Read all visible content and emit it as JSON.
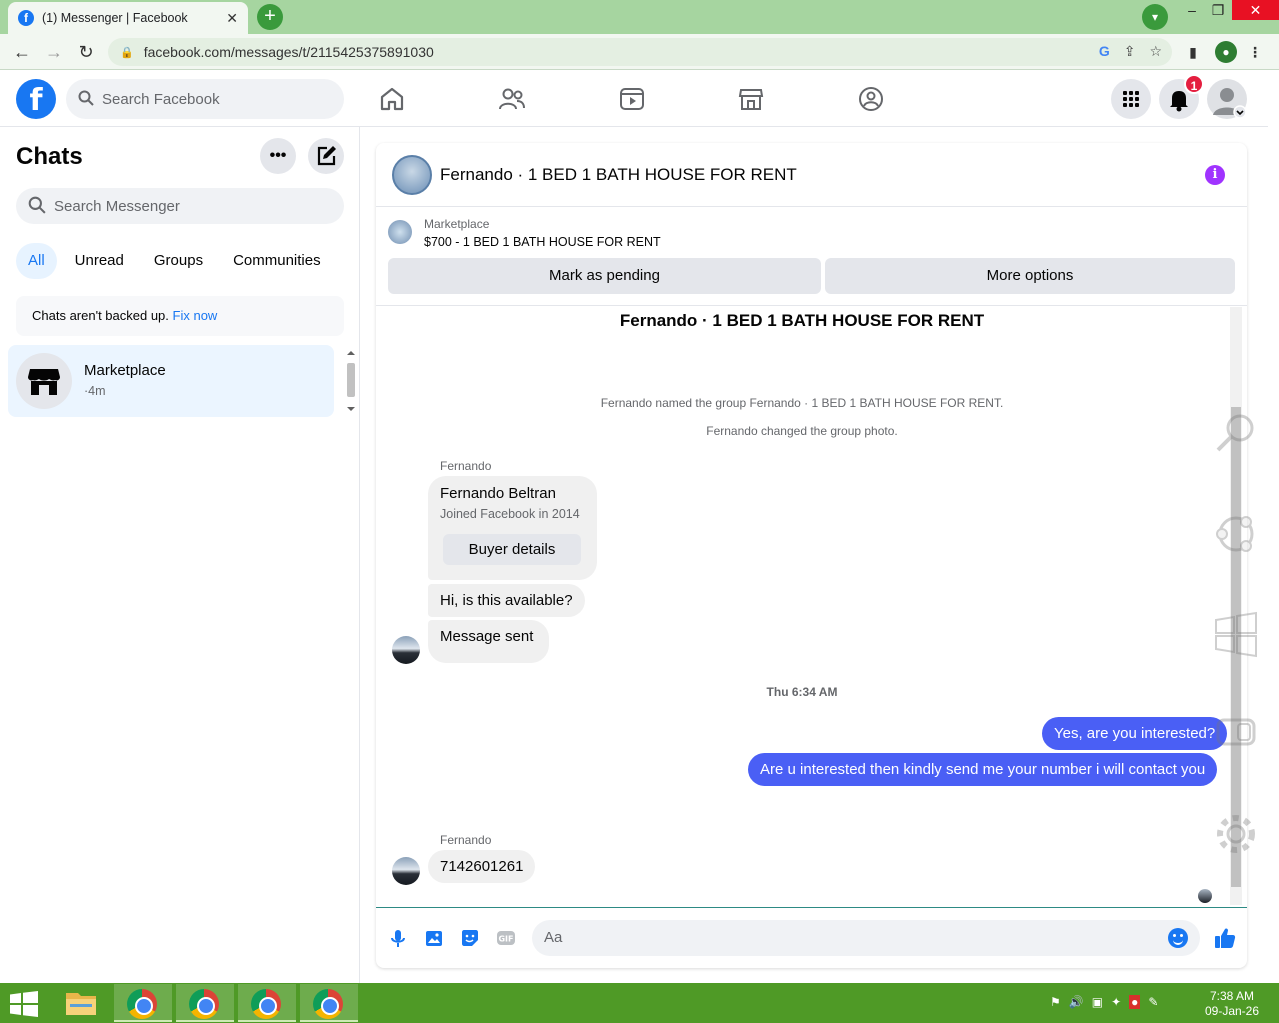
{
  "browser": {
    "tab_title": "(1) Messenger | Facebook",
    "url": "facebook.com/messages/t/2115425375891030"
  },
  "fb": {
    "search_placeholder": "Search Facebook",
    "notification_count": "1"
  },
  "sidebar": {
    "title": "Chats",
    "search_placeholder": "Search Messenger",
    "filters": [
      "All",
      "Unread",
      "Groups",
      "Communities"
    ],
    "backup_text": "Chats aren't backed up.",
    "backup_link": "Fix now",
    "chat": {
      "name": "Marketplace",
      "time": "·4m"
    }
  },
  "conversation": {
    "title": "Fernando · 1 BED 1 BATH HOUSE FOR RENT",
    "marketplace_label": "Marketplace",
    "listing": "$700 - 1 BED 1 BATH HOUSE FOR RENT",
    "mark_pending": "Mark as pending",
    "more_options": "More options",
    "heading": "Fernando · 1 BED 1 BATH HOUSE FOR RENT",
    "system_1": "Fernando named the group Fernando · 1 BED 1 BATH HOUSE FOR RENT.",
    "system_2": "Fernando changed the group photo.",
    "sender_1": "Fernando",
    "profile_name": "Fernando Beltran",
    "profile_sub": "Joined Facebook in 2014",
    "buyer_details": "Buyer details",
    "msg_1": "Hi, is this available?",
    "msg_2": "Message sent",
    "timestamp": "Thu 6:34 AM",
    "out_1": "Yes, are you interested?",
    "out_2": "Are u interested then kindly send me your number i will contact you",
    "sender_2": "Fernando",
    "msg_3": "7142601261",
    "composer_placeholder": "Aa"
  },
  "taskbar": {
    "time": "7:38 AM",
    "date": "09-Jan-26"
  },
  "colors": {
    "fb_blue": "#1877f2",
    "outgoing_bubble": "#4a5ff5",
    "info_purple": "#a033ff",
    "taskbar_green": "#4f9a26",
    "chrome_tab_green": "#a6d5a0"
  }
}
